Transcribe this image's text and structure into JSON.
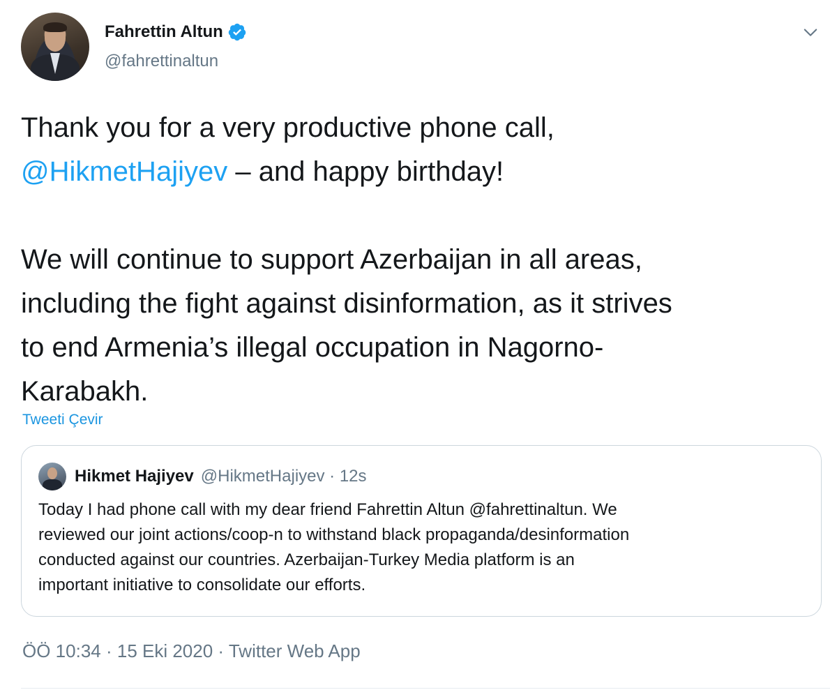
{
  "author": {
    "name": "Fahrettin Altun",
    "handle": "@fahrettinaltun",
    "verified": true
  },
  "tweet": {
    "line1": "Thank you for a very productive phone call,",
    "mention": "@HikmetHajiyev",
    "line2_rest": " – and happy birthday!",
    "line3": "We will continue to support Azerbaijan in all areas,",
    "line4": "including the fight against disinformation, as it strives",
    "line5": "to end Armenia’s illegal occupation in Nagorno-",
    "line6": "Karabakh."
  },
  "translate_link": "Tweeti Çevir",
  "quoted": {
    "name": "Hikmet Hajiyev",
    "meta": "@HikmetHajiyev · 12s",
    "lines": [
      "Today I had phone call with my dear friend Fahrettin Altun @fahrettinaltun. We",
      "reviewed our joint actions/coop-n to withstand black propaganda/desinformation",
      "conducted against our countries.  Azerbaijan-Turkey Media platform is an",
      "important initiative to consolidate our efforts."
    ]
  },
  "footer": {
    "time": "ÖÖ 10:34",
    "date": "15 Eki 2020",
    "source": "Twitter Web App"
  },
  "colors": {
    "link": "#1da1f2",
    "secondary": "#657786",
    "border": "#ccd6dd"
  },
  "icons": [
    "verified-badge-icon",
    "chevron-down-icon"
  ]
}
